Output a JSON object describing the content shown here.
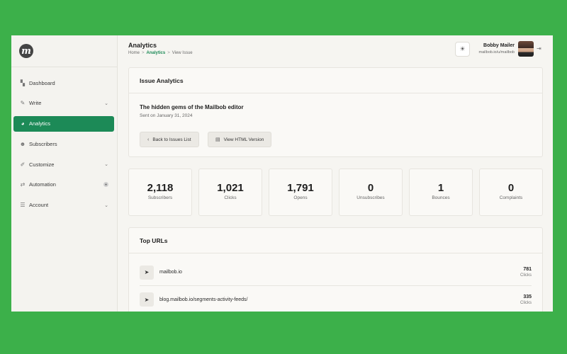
{
  "sidebar": {
    "logo_letter": "m",
    "items": [
      {
        "label": "Dashboard",
        "icon": "grid-icon",
        "glyph": "▚"
      },
      {
        "label": "Write",
        "icon": "pencil-icon",
        "glyph": "✎",
        "chevron": "⌄"
      },
      {
        "label": "Analytics",
        "icon": "pie-chart-icon",
        "glyph": "◕",
        "active": true
      },
      {
        "label": "Subscribers",
        "icon": "users-icon",
        "glyph": "☻"
      },
      {
        "label": "Customize",
        "icon": "brush-icon",
        "glyph": "✐",
        "chevron": "⌄"
      },
      {
        "label": "Automation",
        "icon": "flow-icon",
        "glyph": "⇄",
        "badge": "●"
      },
      {
        "label": "Account",
        "icon": "sliders-icon",
        "glyph": "☰",
        "chevron": "⌄"
      }
    ]
  },
  "header": {
    "title": "Analytics",
    "breadcrumb": [
      "Home",
      "Analytics",
      "View Issue"
    ],
    "breadcrumb_sep": ">",
    "theme_glyph": "☀",
    "user_name": "Bobby Mailer",
    "user_url": "mailbob.io/u/mailbob",
    "logout_glyph": "⇥"
  },
  "issue": {
    "card_title": "Issue Analytics",
    "title": "The hidden gems of the Mailbob editor",
    "sent": "Sent on January 31, 2024",
    "back_label": "Back to Issues List",
    "back_glyph": "‹",
    "html_label": "View HTML Version",
    "html_glyph": "▤"
  },
  "stats": [
    {
      "value": "2,118",
      "label": "Subscribers"
    },
    {
      "value": "1,021",
      "label": "Clicks"
    },
    {
      "value": "1,791",
      "label": "Opens"
    },
    {
      "value": "0",
      "label": "Unsubscribes"
    },
    {
      "value": "1",
      "label": "Bounces"
    },
    {
      "value": "0",
      "label": "Complaints"
    }
  ],
  "top_urls": {
    "title": "Top URLs",
    "cursor_glyph": "➤",
    "rows": [
      {
        "url": "mailbob.io",
        "count": "781",
        "unit": "Clicks"
      },
      {
        "url": "blog.mailbob.io/segments-activity-feeds/",
        "count": "335",
        "unit": "Clicks"
      }
    ]
  },
  "colors": {
    "accent": "#1c8a57",
    "frame": "#3cb04a"
  }
}
